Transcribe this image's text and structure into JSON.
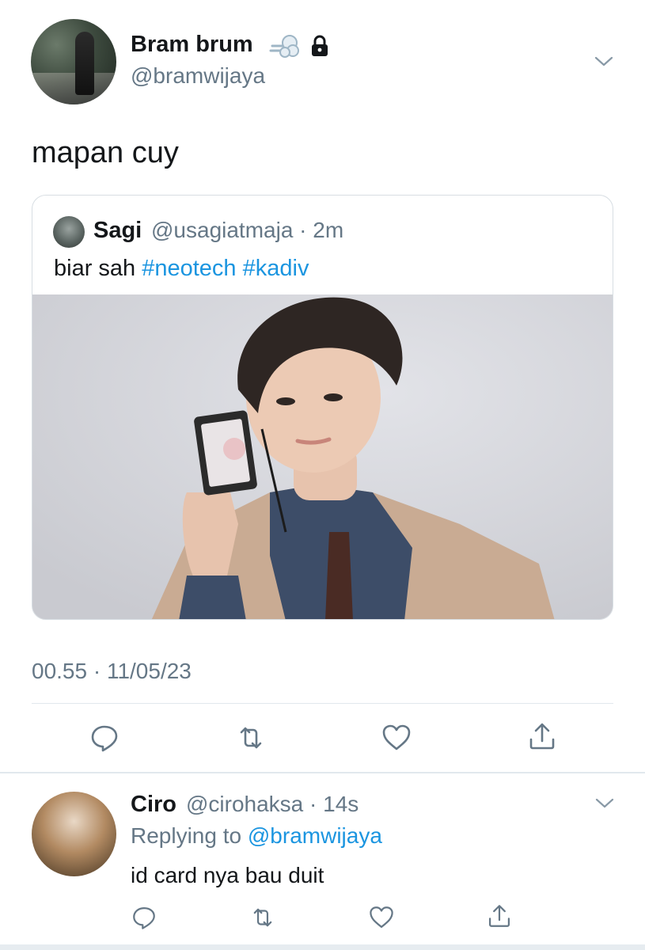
{
  "tweet": {
    "author_name": "Bram brum",
    "author_handle": "@bramwijaya",
    "text": "mapan cuy",
    "timestamp": "00.55 · 11/05/23"
  },
  "quoted_tweet": {
    "author_name": "Sagi",
    "author_handle": "@usagiatmaja",
    "time_ago": "2m",
    "text_prefix": "biar sah",
    "hashtags": [
      "#neotech",
      "#kadiv"
    ]
  },
  "reply": {
    "author_name": "Ciro",
    "author_handle": "@cirohaksa",
    "time_ago": "14s",
    "replying_label": "Replying to",
    "replying_to": "@bramwijaya",
    "text": "id card nya bau duit"
  },
  "colors": {
    "link": "#1b95e0",
    "secondary_text": "#657786",
    "primary_text": "#14171a",
    "divider": "#e1e8ed"
  },
  "icons": [
    "dash-emoji",
    "lock-icon",
    "chevron-down-icon",
    "reply-icon",
    "retweet-icon",
    "like-icon",
    "share-icon"
  ]
}
